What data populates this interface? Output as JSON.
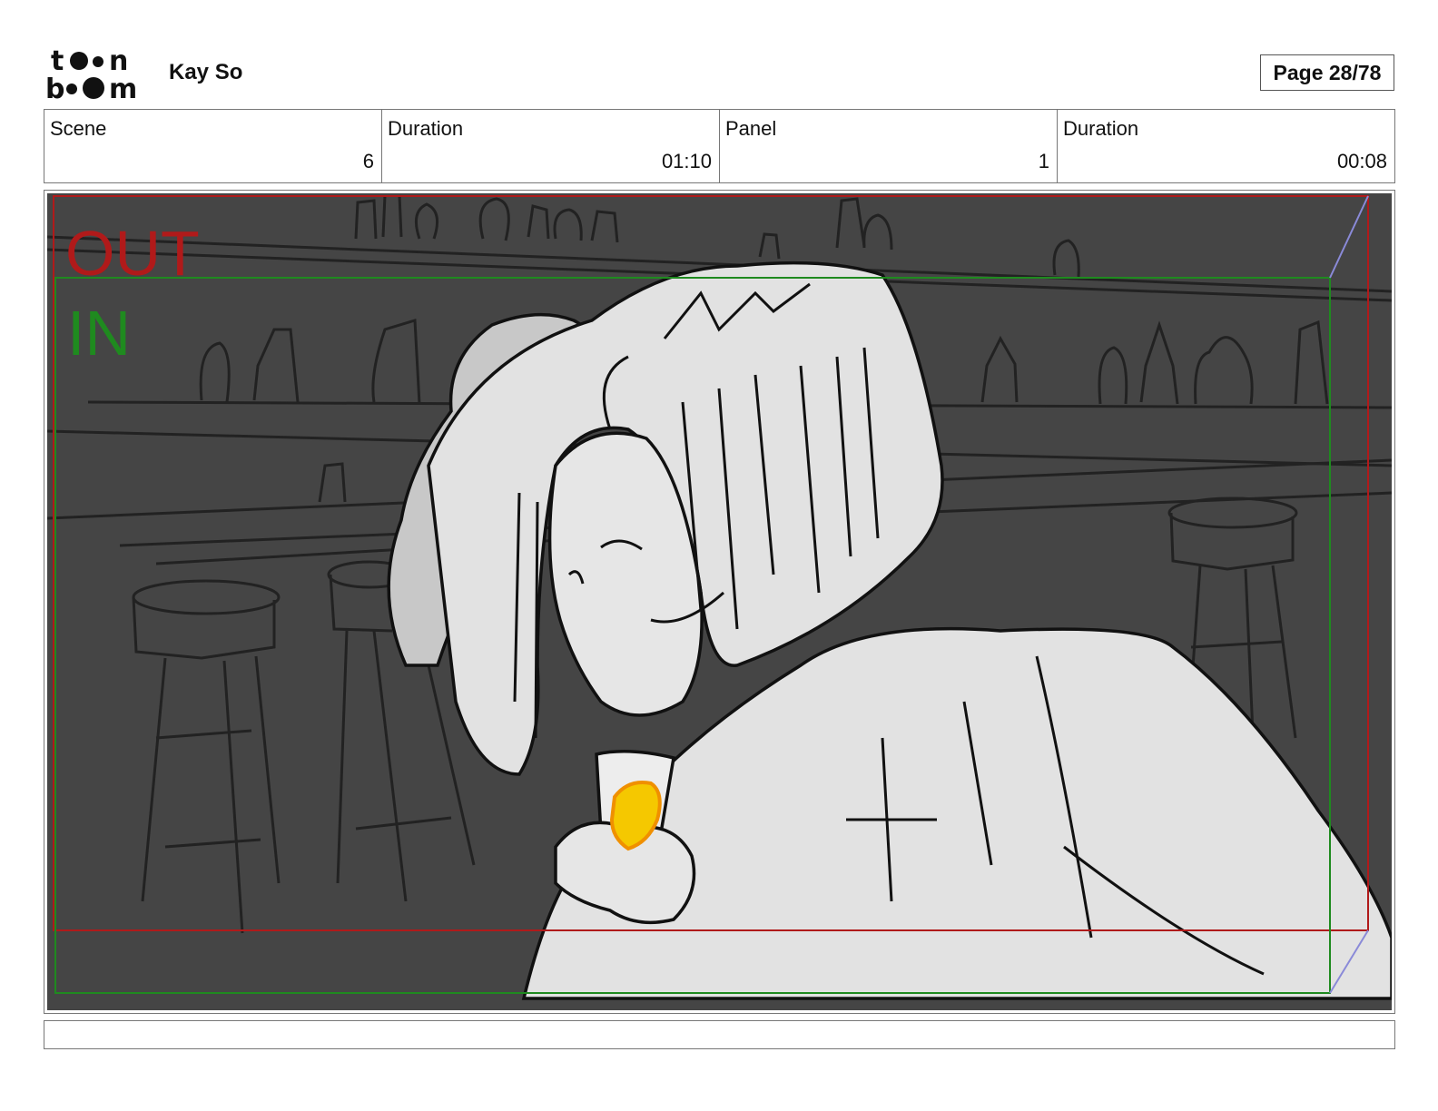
{
  "header": {
    "logo_text": "toon boom",
    "author": "Kay So",
    "page_label": "Page 28/78"
  },
  "info": [
    {
      "label": "Scene",
      "value": "6"
    },
    {
      "label": "Duration",
      "value": "01:10"
    },
    {
      "label": "Panel",
      "value": "1"
    },
    {
      "label": "Duration",
      "value": "00:08"
    }
  ],
  "panel": {
    "out_label": "OUT",
    "in_label": "IN",
    "colors": {
      "background": "#454545",
      "sketch_fill": "#e2e2e2",
      "out_frame": "#b01a1a",
      "in_frame": "#1f8a1f",
      "glow": "#f5c800"
    }
  },
  "caption": ""
}
